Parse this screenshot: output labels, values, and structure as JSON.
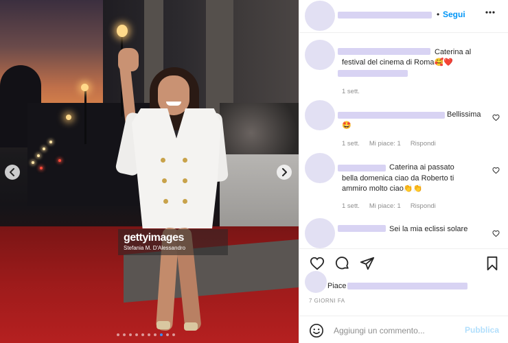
{
  "photo": {
    "watermark_brand": "gettyimages",
    "watermark_credit": "Stefania M. D'Alessandro",
    "carousel_dots_count": 10,
    "carousel_active_index": 7
  },
  "header": {
    "follow_separator": "•",
    "follow_label": "Segui",
    "more_label": "•••"
  },
  "comments": [
    {
      "text_line1": "Caterina al",
      "text_line2": "festival del cinema di Roma🥰❤️",
      "time": "1 sett.",
      "likes": "",
      "reply": ""
    },
    {
      "text": "Bellissima",
      "text_line2": "🤩",
      "time": "1 sett.",
      "likes": "Mi piace: 1",
      "reply": "Rispondi"
    },
    {
      "text_line1": "Caterina ai passato",
      "text_line2": "bella domenica ciao da Roberto ti",
      "text_line3": "ammiro molto ciao👏👏",
      "time": "1 sett.",
      "likes": "Mi piace: 1",
      "reply": "Rispondi"
    },
    {
      "text": "Sei la mia eclissi solare",
      "time": "",
      "likes": "",
      "reply": ""
    }
  ],
  "likes": {
    "text": "Piace"
  },
  "post_date": "7 GIORNI FA",
  "comment_box": {
    "placeholder": "Aggiungi un commento...",
    "publish_label": "Pubblica"
  },
  "colors": {
    "accent": "#0095f6",
    "publish_disabled": "#b2dffc",
    "muted": "#8e8e8e",
    "redacted": "#d8d3f3"
  }
}
